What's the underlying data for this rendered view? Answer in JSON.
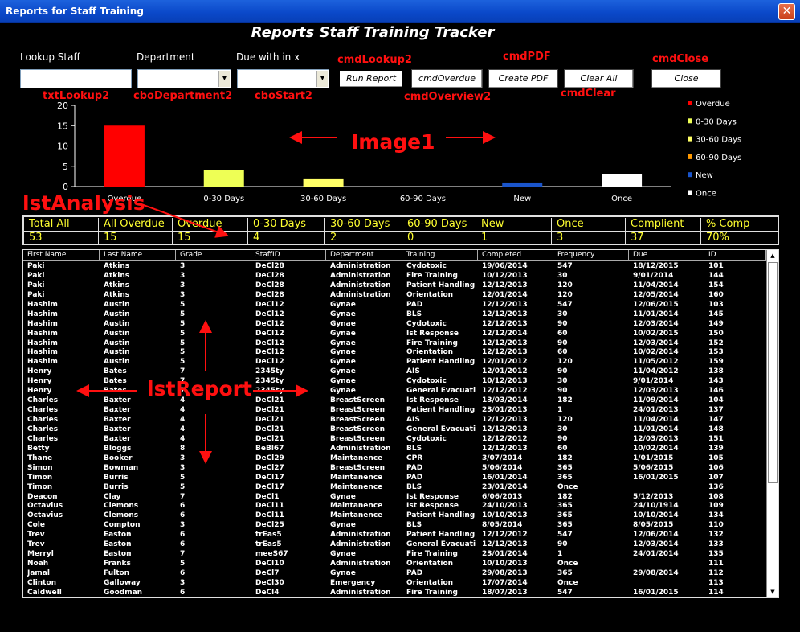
{
  "window": {
    "title": "Reports for Staff Training",
    "close_glyph": "✕"
  },
  "form_title": "Reports Staff Training Tracker",
  "labels": {
    "lookup_staff": "Lookup Staff",
    "department": "Department",
    "due_within": "Due with in x"
  },
  "buttons": {
    "run_report": "Run Report",
    "overdue": "cmdOverdue",
    "create_pdf": "Create PDF",
    "clear_all": "Clear All",
    "close": "Close"
  },
  "annotations": {
    "cmdLookup2": "cmdLookup2",
    "cmdPDF": "cmdPDF",
    "cmdClose": "cmdClose",
    "txtLookup2": "txtLookup2",
    "cboDepartment2": "cboDepartment2",
    "cboStart2": "cboStart2",
    "cmdOverview2": "cmdOverview2",
    "cmdClear": "cmdClear",
    "image1": "Image1",
    "lstAnalysis": "lstAnalysis",
    "lstReport": "lstReport",
    "color": "#ff1010"
  },
  "chart_data": {
    "type": "bar",
    "categories": [
      "Overdue",
      "0-30 Days",
      "30-60 Days",
      "60-90 Days",
      "New",
      "Once"
    ],
    "values": [
      15,
      4,
      2,
      0,
      1,
      3
    ],
    "colors": [
      "#ff0000",
      "#eeff55",
      "#ffff66",
      "#ff9900",
      "#1a55cc",
      "#ffffff"
    ],
    "ylim": [
      0,
      20
    ],
    "yticks": [
      0,
      5,
      10,
      15,
      20
    ],
    "legend_position": "right",
    "legend": [
      "Overdue",
      "0-30 Days",
      "30-60 Days",
      "60-90 Days",
      "New",
      "Once"
    ],
    "grid": false,
    "title": "",
    "xlabel": "",
    "ylabel": ""
  },
  "analysis": {
    "headers": [
      "Total All",
      "All Overdue",
      "Overdue",
      "0-30 Days",
      "30-60 Days",
      "60-90 Days",
      "New",
      "Once",
      "Complient",
      "% Comp"
    ],
    "values": [
      "53",
      "15",
      "15",
      "4",
      "2",
      "0",
      "1",
      "3",
      "37",
      "70%"
    ]
  },
  "report": {
    "columns": [
      "First Name",
      "Last Name",
      "Grade",
      "StaffID",
      "Department",
      "Training",
      "Completed",
      "Frequency",
      "Due",
      "ID"
    ],
    "rows": [
      [
        "Paki",
        "Atkins",
        "3",
        "DeCl28",
        "Administration",
        "Cydotoxic",
        "19/06/2014",
        "547",
        "18/12/2015",
        "101"
      ],
      [
        "Paki",
        "Atkins",
        "3",
        "DeCl28",
        "Administration",
        "Fire Training",
        "10/12/2013",
        "30",
        "9/01/2014",
        "144"
      ],
      [
        "Paki",
        "Atkins",
        "3",
        "DeCl28",
        "Administration",
        "Patient Handling",
        "12/12/2013",
        "120",
        "11/04/2014",
        "154"
      ],
      [
        "Paki",
        "Atkins",
        "3",
        "DeCl28",
        "Administration",
        "Orientation",
        "12/01/2014",
        "120",
        "12/05/2014",
        "160"
      ],
      [
        "Hashim",
        "Austin",
        "5",
        "DeCl12",
        "Gynae",
        "PAD",
        "12/12/2013",
        "547",
        "12/06/2015",
        "103"
      ],
      [
        "Hashim",
        "Austin",
        "5",
        "DeCl12",
        "Gynae",
        "BLS",
        "12/12/2013",
        "30",
        "11/01/2014",
        "145"
      ],
      [
        "Hashim",
        "Austin",
        "5",
        "DeCl12",
        "Gynae",
        "Cydotoxic",
        "12/12/2013",
        "90",
        "12/03/2014",
        "149"
      ],
      [
        "Hashim",
        "Austin",
        "5",
        "DeCl12",
        "Gynae",
        "Ist Response",
        "12/12/2014",
        "60",
        "10/02/2015",
        "150"
      ],
      [
        "Hashim",
        "Austin",
        "5",
        "DeCl12",
        "Gynae",
        "Fire Training",
        "12/12/2013",
        "90",
        "12/03/2014",
        "152"
      ],
      [
        "Hashim",
        "Austin",
        "5",
        "DeCl12",
        "Gynae",
        "Orientation",
        "12/12/2013",
        "60",
        "10/02/2014",
        "153"
      ],
      [
        "Hashim",
        "Austin",
        "5",
        "DeCl12",
        "Gynae",
        "Patient Handling",
        "12/01/2012",
        "120",
        "11/05/2012",
        "159"
      ],
      [
        "Henry",
        "Bates",
        "7",
        "2345ty",
        "Gynae",
        "AIS",
        "12/01/2012",
        "90",
        "11/04/2012",
        "138"
      ],
      [
        "Henry",
        "Bates",
        "7",
        "2345ty",
        "Gynae",
        "Cydotoxic",
        "10/12/2013",
        "30",
        "9/01/2014",
        "143"
      ],
      [
        "Henry",
        "Bates",
        "7",
        "2345ty",
        "Gynae",
        "General Evacuati",
        "12/12/2012",
        "90",
        "12/03/2013",
        "146"
      ],
      [
        "Charles",
        "Baxter",
        "4",
        "DeCl21",
        "BreastScreen",
        "Ist Response",
        "13/03/2014",
        "182",
        "11/09/2014",
        "104"
      ],
      [
        "Charles",
        "Baxter",
        "4",
        "DeCl21",
        "BreastScreen",
        "Patient Handling",
        "23/01/2013",
        "1",
        "24/01/2013",
        "137"
      ],
      [
        "Charles",
        "Baxter",
        "4",
        "DeCl21",
        "BreastScreen",
        "AIS",
        "12/12/2013",
        "120",
        "11/04/2014",
        "147"
      ],
      [
        "Charles",
        "Baxter",
        "4",
        "DeCl21",
        "BreastScreen",
        "General Evacuati",
        "12/12/2013",
        "30",
        "11/01/2014",
        "148"
      ],
      [
        "Charles",
        "Baxter",
        "4",
        "DeCl21",
        "BreastScreen",
        "Cydotoxic",
        "12/12/2012",
        "90",
        "12/03/2013",
        "151"
      ],
      [
        "Betty",
        "Bloggs",
        "8",
        "BeBl67",
        "Administration",
        "BLS",
        "12/12/2013",
        "60",
        "10/02/2014",
        "139"
      ],
      [
        "Thane",
        "Booker",
        "3",
        "DeCl29",
        "Maintanence",
        "CPR",
        "3/07/2014",
        "182",
        "1/01/2015",
        "105"
      ],
      [
        "Simon",
        "Bowman",
        "3",
        "DeCl27",
        "BreastScreen",
        "PAD",
        "5/06/2014",
        "365",
        "5/06/2015",
        "106"
      ],
      [
        "Timon",
        "Burris",
        "5",
        "DeCl17",
        "Maintanence",
        "PAD",
        "16/01/2014",
        "365",
        "16/01/2015",
        "107"
      ],
      [
        "Timon",
        "Burris",
        "5",
        "DeCl17",
        "Maintanence",
        "BLS",
        "23/01/2014",
        "Once",
        "",
        "136"
      ],
      [
        "Deacon",
        "Clay",
        "7",
        "DeCl1",
        "Gynae",
        "Ist Response",
        "6/06/2013",
        "182",
        "5/12/2013",
        "108"
      ],
      [
        "Octavius",
        "Clemons",
        "6",
        "DeCl11",
        "Maintanence",
        "Ist Response",
        "24/10/2013",
        "365",
        "24/10/1914",
        "109"
      ],
      [
        "Octavius",
        "Clemons",
        "6",
        "DeCl11",
        "Maintanence",
        "Patient Handling",
        "10/10/2013",
        "365",
        "10/10/2014",
        "134"
      ],
      [
        "Cole",
        "Compton",
        "3",
        "DeCl25",
        "Gynae",
        "BLS",
        "8/05/2014",
        "365",
        "8/05/2015",
        "110"
      ],
      [
        "Trev",
        "Easton",
        "6",
        "trEas5",
        "Administration",
        "Patient Handling",
        "12/12/2012",
        "547",
        "12/06/2014",
        "132"
      ],
      [
        "Trev",
        "Easton",
        "6",
        "trEas5",
        "Administration",
        "General Evacuati",
        "12/12/2013",
        "90",
        "12/03/2014",
        "133"
      ],
      [
        "Merryl",
        "Easton",
        "7",
        "meeS67",
        "Gynae",
        "Fire Training",
        "23/01/2014",
        "1",
        "24/01/2014",
        "135"
      ],
      [
        "Noah",
        "Franks",
        "5",
        "DeCl10",
        "Administration",
        "Orientation",
        "10/10/2013",
        "Once",
        "",
        "111"
      ],
      [
        "Jamal",
        "Fulton",
        "6",
        "DeCl7",
        "Gynae",
        "PAD",
        "29/08/2013",
        "365",
        "29/08/2014",
        "112"
      ],
      [
        "Clinton",
        "Galloway",
        "3",
        "DeCl30",
        "Emergency",
        "Orientation",
        "17/07/2014",
        "Once",
        "",
        "113"
      ],
      [
        "Caldwell",
        "Goodman",
        "6",
        "DeCl4",
        "Administration",
        "Fire Training",
        "18/07/2013",
        "547",
        "16/01/2015",
        "114"
      ]
    ]
  }
}
